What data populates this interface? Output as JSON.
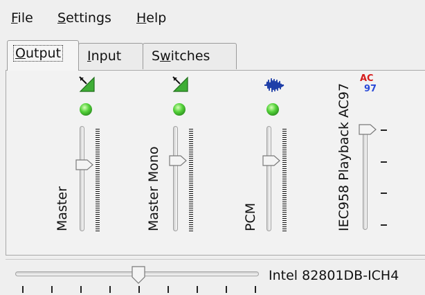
{
  "menubar": {
    "file": {
      "mnemonic": "F",
      "rest": "ile"
    },
    "settings": {
      "mnemonic": "S",
      "rest": "ettings"
    },
    "help": {
      "mnemonic": "H",
      "rest": "elp"
    }
  },
  "tabs": {
    "output": {
      "mnemonic": "O",
      "rest": "utput"
    },
    "input": {
      "mnemonic": "I",
      "rest": "nput"
    },
    "switches": {
      "pre": "S",
      "mnemonic": "w",
      "rest": "itches"
    }
  },
  "channels": [
    {
      "name": "Master",
      "icon": "volume-ramp-icon",
      "muted": false,
      "level": 0.45
    },
    {
      "name": "Master Mono",
      "icon": "volume-ramp-icon",
      "muted": false,
      "level": 0.45
    },
    {
      "name": "PCM",
      "icon": "waveform-icon",
      "muted": false,
      "level": 0.45
    },
    {
      "name": "IEC958 Playback AC97",
      "icon": "ac97-icon",
      "level": 1.0
    }
  ],
  "ac97_icon": {
    "top": "AC",
    "bottom": "97"
  },
  "global_slider": {
    "level": 0.5
  },
  "card_name": "Intel 82801DB-ICH4",
  "colors": {
    "led": "#55d23a",
    "ramp": "#2f9a2a",
    "waveform": "#1f3fa8",
    "ac_red": "#d61b1b",
    "ac_blue": "#2a4ad8"
  }
}
